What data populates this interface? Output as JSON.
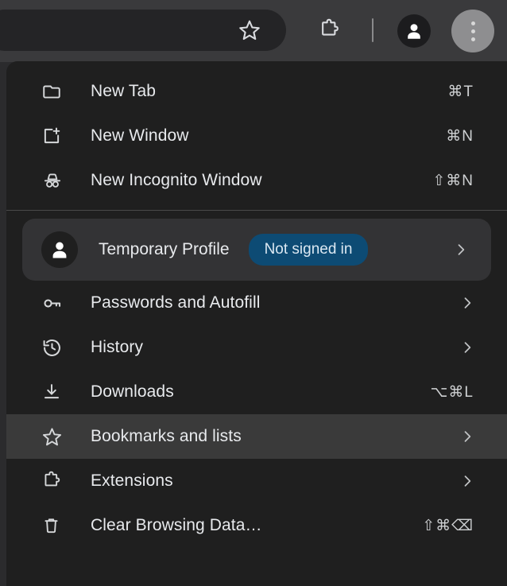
{
  "toolbar": {
    "omnibox_value": "",
    "omnibox_placeholder": "",
    "bookmark_star_label": "Bookmark this tab",
    "extensions_label": "Extensions",
    "profile_label": "Profile",
    "menu_label": "Customize and control Chrome"
  },
  "menu": {
    "groups": [
      {
        "items": [
          {
            "label": "New Tab",
            "icon": "new-tab-icon",
            "accel": "⌘T",
            "chevron": false
          },
          {
            "label": "New Window",
            "icon": "new-window-icon",
            "accel": "⌘N",
            "chevron": false
          },
          {
            "label": "New Incognito Window",
            "icon": "incognito-icon",
            "accel": "⇧⌘N",
            "chevron": false
          }
        ]
      }
    ],
    "profile": {
      "name": "Temporary Profile",
      "badge": "Not signed in",
      "avatar_icon": "person-icon",
      "chevron_icon": "chevron-right-icon"
    },
    "items": [
      {
        "label": "Passwords and Autofill",
        "icon": "key-icon",
        "accel": "",
        "chevron": true,
        "highlight": false
      },
      {
        "label": "History",
        "icon": "history-icon",
        "accel": "",
        "chevron": true,
        "highlight": false
      },
      {
        "label": "Downloads",
        "icon": "download-icon",
        "accel": "⌥⌘L",
        "chevron": false,
        "highlight": false
      },
      {
        "label": "Bookmarks and lists",
        "icon": "star-icon",
        "accel": "",
        "chevron": true,
        "highlight": true
      },
      {
        "label": "Extensions",
        "icon": "puzzle-icon",
        "accel": "",
        "chevron": true,
        "highlight": false
      },
      {
        "label": "Clear Browsing Data…",
        "icon": "trash-icon",
        "accel": "⇧⌘⌫",
        "chevron": false,
        "highlight": false
      }
    ]
  },
  "colors": {
    "menu_background": "#1f1f1f",
    "toolbar_background": "#3a3a3c",
    "highlight_row": "#3a3a3a",
    "badge_blue": "#0d4b74",
    "text_primary": "#e8eaed",
    "profile_card": "#333335"
  }
}
